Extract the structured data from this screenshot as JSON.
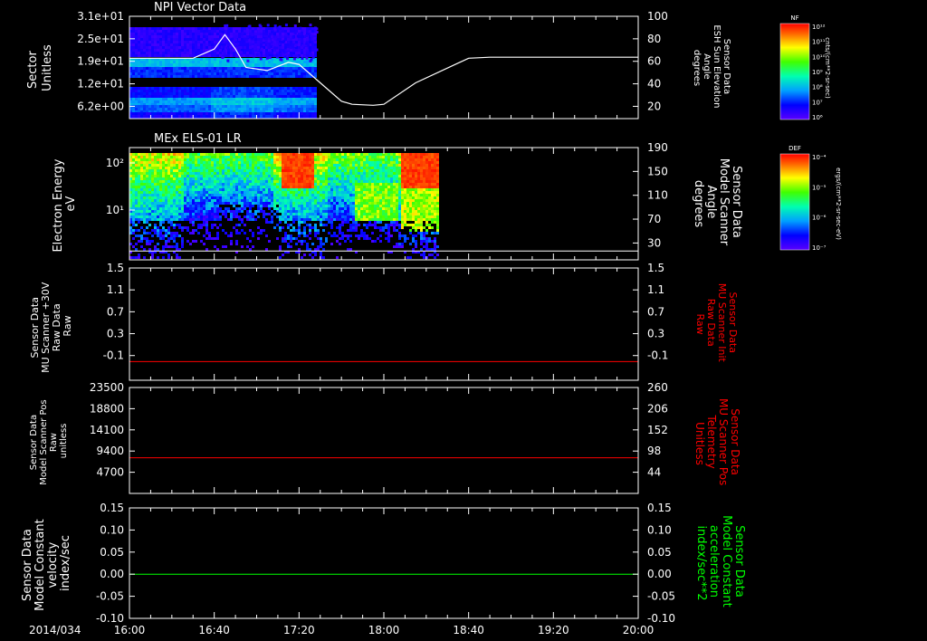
{
  "chart_data": [
    {
      "type": "heatmap",
      "title": "NPI Vector Data",
      "ylabel": [
        "Sector",
        "Unitless"
      ],
      "yticks": [
        "3.1e+01",
        "2.5e+01",
        "1.9e+01",
        "1.2e+01",
        "6.2e+00"
      ],
      "y2label": [
        "Sensor Data",
        "ESH Sun Elevation",
        "Angle",
        "degrees"
      ],
      "y2ticks": [
        "100",
        "80",
        "60",
        "40",
        "20"
      ],
      "y2lim": [
        0,
        100
      ],
      "overlay_line": {
        "color": "#ffffff",
        "x_minutes": [
          0,
          30,
          40,
          45,
          50,
          55,
          65,
          75,
          80,
          90,
          100,
          105,
          115,
          120,
          135,
          160,
          170,
          240
        ],
        "y_degrees": [
          59,
          59,
          68,
          82,
          68,
          50,
          47,
          55,
          53,
          35,
          17,
          14,
          13,
          14,
          35,
          59,
          60,
          60
        ]
      },
      "colorbar": {
        "title": "NF",
        "unit": "cnts/(cm**2-sr-sec)",
        "ticks": [
          "10¹²",
          "10¹¹",
          "10¹⁰",
          "10⁹",
          "10⁸",
          "10⁷",
          "10⁶"
        ]
      },
      "data_end_minutes": 88
    },
    {
      "type": "heatmap",
      "title": "MEx ELS-01 LR",
      "ylabel": [
        "Electron Energy",
        "eV"
      ],
      "yticks": [
        "10²",
        "10¹"
      ],
      "y2label": [
        "Sensor Data",
        "Model Scanner",
        "Angle",
        "degrees"
      ],
      "y2ticks": [
        "190",
        "150",
        "110",
        "70",
        "30"
      ],
      "y2lim": [
        0,
        190
      ],
      "overlay_value": 15,
      "colorbar": {
        "title": "DEF",
        "unit": "ergs/(cm**2-sr-sec-eV)",
        "ticks": [
          "10⁻⁴",
          "10⁻⁵",
          "10⁻⁶",
          "10⁻⁷"
        ]
      },
      "data_end_minutes": 146
    },
    {
      "type": "line",
      "ylabel": [
        "Sensor Data",
        "MU Scanner +30V",
        "Raw Data",
        "Raw"
      ],
      "yticks": [
        "1.5",
        "1.1",
        "0.7",
        "0.3",
        "-0.1"
      ],
      "ylim": [
        -0.3,
        1.5
      ],
      "y2label": [
        "Sensor Data",
        "MU Scanner Init",
        "Raw Data",
        "Raw"
      ],
      "y2ticks": [
        "1.5",
        "1.1",
        "0.7",
        "0.3",
        "-0.1"
      ],
      "series": [
        {
          "color": "#ff0000",
          "x_minutes": [
            0,
            240
          ],
          "values": [
            0.0,
            0.0
          ]
        }
      ]
    },
    {
      "type": "line",
      "ylabel": [
        "Sensor Data",
        "Model Scanner Pos",
        "Raw",
        "unitless"
      ],
      "yticks": [
        "23500",
        "18800",
        "14100",
        "9400",
        "4700"
      ],
      "ylim": [
        0,
        23500
      ],
      "y2label": [
        "Sensor Data",
        "MU Scanner Pos",
        "Telemetry",
        "Unitless"
      ],
      "y2ticks": [
        "260",
        "206",
        "152",
        "98",
        "44"
      ],
      "series": [
        {
          "color": "#ff0000",
          "x_minutes": [
            0,
            240
          ],
          "values": [
            7900,
            7900
          ]
        }
      ]
    },
    {
      "type": "line",
      "ylabel": [
        "Sensor Data",
        "Model Constant",
        "velocity",
        "index/sec"
      ],
      "yticks": [
        "0.15",
        "0.10",
        "0.05",
        "0.00",
        "-0.05",
        "-0.10"
      ],
      "ylim": [
        -0.1,
        0.15
      ],
      "y2label": [
        "Sensor Data",
        "Model Constant",
        "acceleration",
        "index/sec**2"
      ],
      "y2ticks": [
        "0.15",
        "0.10",
        "0.05",
        "0.00",
        "-0.05",
        "-0.10"
      ],
      "series": [
        {
          "color": "#00ff00",
          "x_minutes": [
            0,
            240
          ],
          "values": [
            0.0,
            0.0
          ]
        }
      ]
    }
  ],
  "time_axis": {
    "date_label": "2014/034",
    "ticks": [
      "16:00",
      "16:40",
      "17:20",
      "18:00",
      "18:40",
      "19:20",
      "20:00"
    ],
    "range_minutes": [
      0,
      240
    ]
  },
  "colors": {
    "background": "#000000",
    "axes": "#ffffff",
    "red_label": "#ff0000",
    "green_label": "#00ff00"
  }
}
